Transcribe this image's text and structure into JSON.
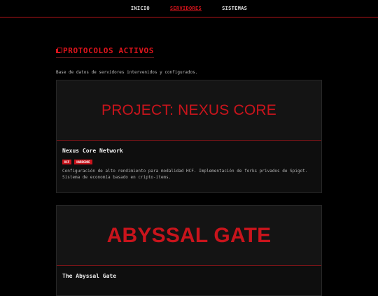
{
  "nav": {
    "items": [
      {
        "label": "INICIO",
        "active": false
      },
      {
        "label": "SERVIDORES",
        "active": true
      },
      {
        "label": "SISTEMAS",
        "active": false
      }
    ]
  },
  "section": {
    "title": "PROTOCOLOS ACTIVOS",
    "icon": "box-icon",
    "intro": "Base de datos de servidores intervenidos y configurados."
  },
  "cards": [
    {
      "banner": "PROJECT: NEXUS CORE",
      "title": "Nexus Core Network",
      "tags": [
        "HCF",
        "HARDCORE"
      ],
      "description": "Configuración de alto rendimiento para modalidad HCF. Implementación de forks privados de Spigot. Sistema de economía basado en cripto-items."
    },
    {
      "banner": "ABYSSAL GATE",
      "title": "The Abyssal Gate"
    }
  ],
  "colors": {
    "accent": "#d8141c",
    "background": "#000000",
    "card": "#0e0e0e"
  }
}
